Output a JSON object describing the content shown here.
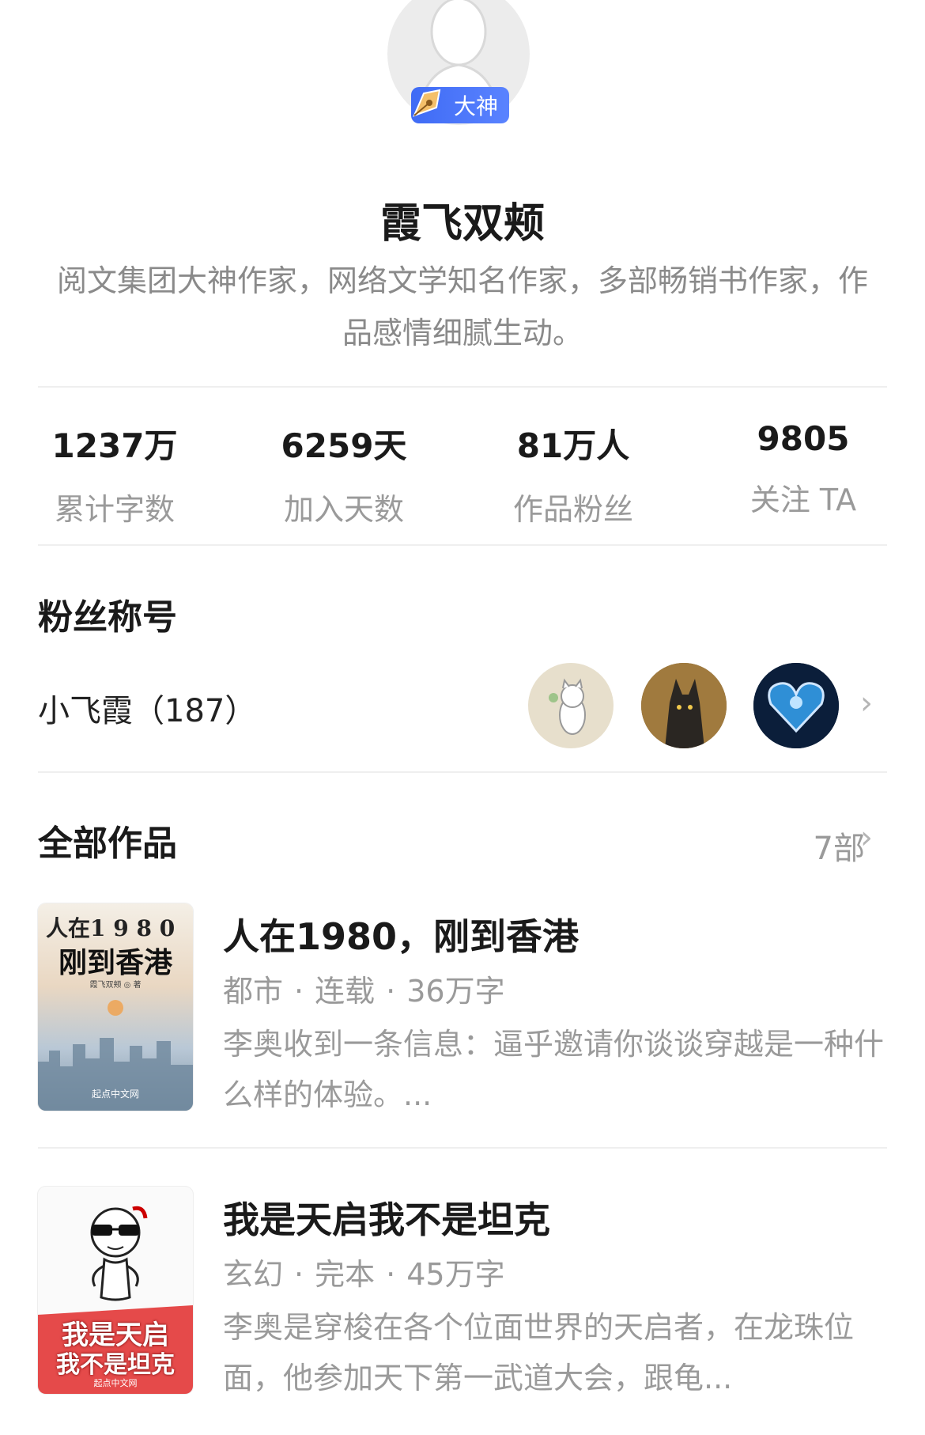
{
  "profile": {
    "badge": "大神",
    "name": "霞飞双颊",
    "bio": "阅文集团大神作家，网络文学知名作家，多部畅销书作家，作品感情细腻生动。"
  },
  "stats": [
    {
      "value": "1237万",
      "label": "累计字数"
    },
    {
      "value": "6259天",
      "label": "加入天数"
    },
    {
      "value": "81万人",
      "label": "作品粉丝"
    },
    {
      "value": "9805",
      "label": "关注 TA"
    }
  ],
  "fans": {
    "title": "粉丝称号",
    "name": "小飞霞（187）"
  },
  "works": {
    "title": "全部作品",
    "count": "7部",
    "books": [
      {
        "cover_line1": "人在1 9 8 0",
        "cover_line2": "刚到香港",
        "cover_author": "霞飞双颊 ◎ 著",
        "cover_brand": "起点中文网",
        "title": "人在1980，刚到香港",
        "genre": "都市",
        "status": "连载",
        "words": "36万字",
        "desc": "李奥收到一条信息：逼乎邀请你谈谈穿越是一种什么样的体验。..."
      },
      {
        "cover_line1": "我是天启",
        "cover_line2": "我不是坦克",
        "cover_brand": "起点中文网",
        "title": "我是天启我不是坦克",
        "genre": "玄幻",
        "status": "完本",
        "words": "45万字",
        "desc": "李奥是穿梭在各个位面世界的天启者，在龙珠位面，他参加天下第一武道大会，跟龟..."
      }
    ]
  },
  "colors": {
    "badge": "#4a74f7",
    "text_primary": "#1a1a1a",
    "text_secondary": "#9a9a9a"
  }
}
